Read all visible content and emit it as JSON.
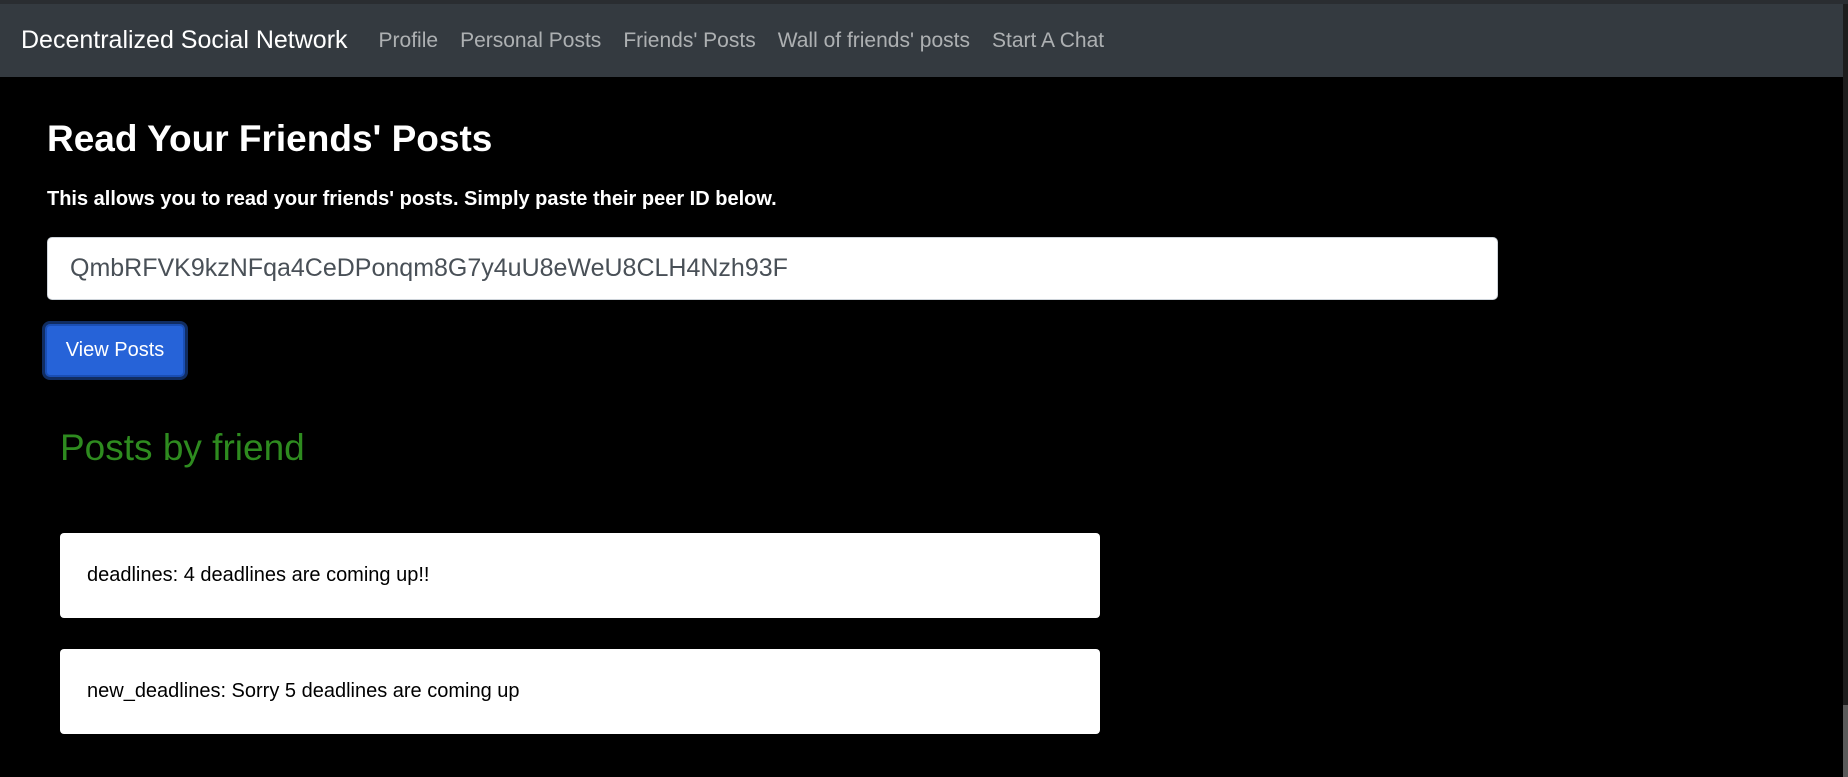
{
  "navbar": {
    "brand": "Decentralized Social Network",
    "links": [
      {
        "label": "Profile"
      },
      {
        "label": "Personal Posts"
      },
      {
        "label": "Friends' Posts"
      },
      {
        "label": "Wall of friends' posts"
      },
      {
        "label": "Start A Chat"
      }
    ]
  },
  "main": {
    "title": "Read Your Friends' Posts",
    "subtitle": "This allows you to read your friends' posts. Simply paste their peer ID below.",
    "peer_input_value": "QmbRFVK9kzNFqa4CeDPonqm8G7y4uU8eWeU8CLH4Nzh93F",
    "view_button_label": "View Posts",
    "section_title": "Posts by friend",
    "posts": [
      {
        "text": "deadlines: 4 deadlines are coming up!!"
      },
      {
        "text": "new_deadlines: Sorry 5 deadlines are coming up"
      }
    ]
  },
  "colors": {
    "navbar_bg": "#343a40",
    "page_bg": "#000000",
    "primary_button": "#2663d8",
    "section_title": "#2e8b1f"
  }
}
